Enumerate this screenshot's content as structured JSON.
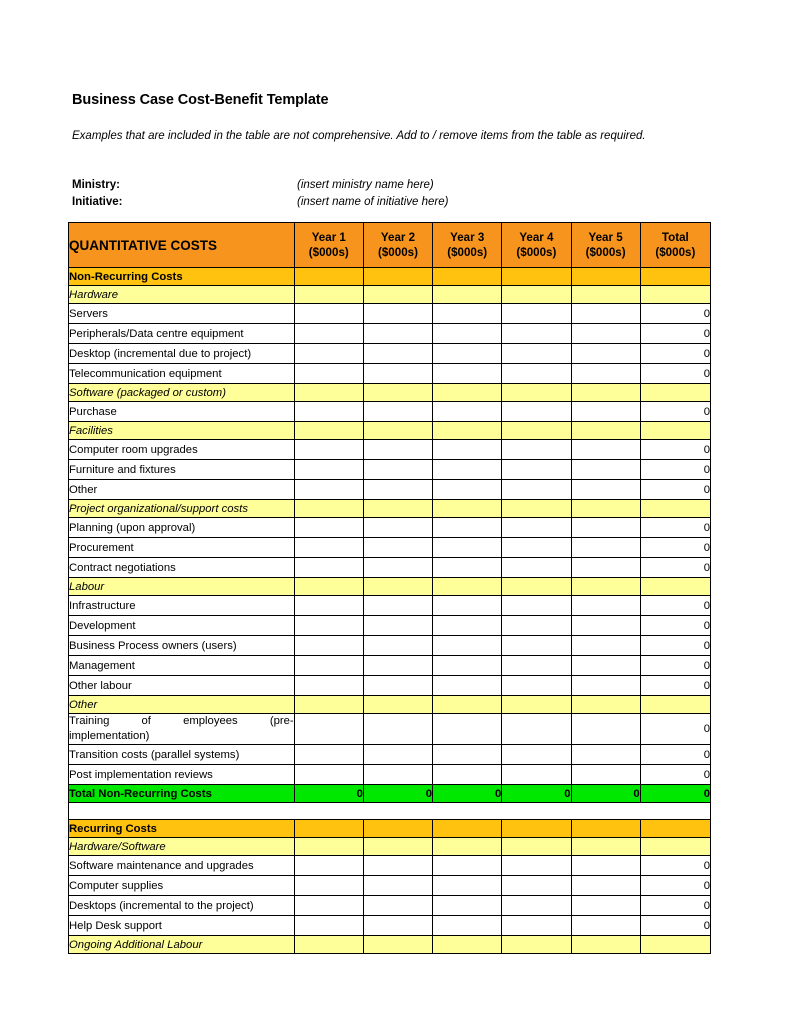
{
  "document": {
    "title": "Business Case Cost-Benefit Template",
    "intro": "Examples that are included in the table are not comprehensive.  Add to / remove items from the table as required.",
    "meta": [
      {
        "label": "Ministry:",
        "value": "(insert ministry name here)"
      },
      {
        "label": "Initiative:",
        "value": "(insert name of initiative here)"
      }
    ]
  },
  "colors": {
    "header_orange": "#F7941E",
    "group_gold": "#FFC20E",
    "subgroup_yellow": "#FFFF99",
    "total_green": "#00E800",
    "border": "#000000",
    "page_background": "#FFFFFF"
  },
  "table": {
    "header": {
      "title": "QUANTITATIVE COSTS",
      "columns": [
        {
          "line1": "Year 1",
          "line2": "($000s)"
        },
        {
          "line1": "Year 2",
          "line2": "($000s)"
        },
        {
          "line1": "Year 3",
          "line2": "($000s)"
        },
        {
          "line1": "Year 4",
          "line2": "($000s)"
        },
        {
          "line1": "Year 5",
          "line2": "($000s)"
        },
        {
          "line1": "Total",
          "line2": "($000s)"
        }
      ]
    },
    "rows": [
      {
        "type": "group",
        "label": "Non-Recurring Costs",
        "values": [
          "",
          "",
          "",
          "",
          "",
          ""
        ]
      },
      {
        "type": "sub",
        "label": "Hardware",
        "values": [
          "",
          "",
          "",
          "",
          "",
          ""
        ]
      },
      {
        "type": "item",
        "label": "Servers",
        "values": [
          "",
          "",
          "",
          "",
          "",
          "0"
        ]
      },
      {
        "type": "item",
        "label": "Peripherals/Data centre equipment",
        "values": [
          "",
          "",
          "",
          "",
          "",
          "0"
        ]
      },
      {
        "type": "item",
        "label": "Desktop (incremental due to project)",
        "values": [
          "",
          "",
          "",
          "",
          "",
          "0"
        ]
      },
      {
        "type": "item",
        "label": "Telecommunication equipment",
        "values": [
          "",
          "",
          "",
          "",
          "",
          "0"
        ]
      },
      {
        "type": "sub",
        "label": "Software (packaged or custom)",
        "values": [
          "",
          "",
          "",
          "",
          "",
          ""
        ]
      },
      {
        "type": "item",
        "label": "Purchase",
        "values": [
          "",
          "",
          "",
          "",
          "",
          "0"
        ]
      },
      {
        "type": "sub",
        "label": "Facilities",
        "values": [
          "",
          "",
          "",
          "",
          "",
          ""
        ]
      },
      {
        "type": "item",
        "label": "Computer room upgrades",
        "values": [
          "",
          "",
          "",
          "",
          "",
          "0"
        ]
      },
      {
        "type": "item",
        "label": "Furniture and fixtures",
        "values": [
          "",
          "",
          "",
          "",
          "",
          "0"
        ]
      },
      {
        "type": "item",
        "label": "Other",
        "values": [
          "",
          "",
          "",
          "",
          "",
          "0"
        ]
      },
      {
        "type": "sub",
        "label": "Project organizational/support costs",
        "values": [
          "",
          "",
          "",
          "",
          "",
          ""
        ]
      },
      {
        "type": "item",
        "label": "Planning (upon approval)",
        "values": [
          "",
          "",
          "",
          "",
          "",
          "0"
        ]
      },
      {
        "type": "item",
        "label": "Procurement",
        "values": [
          "",
          "",
          "",
          "",
          "",
          "0"
        ]
      },
      {
        "type": "item",
        "label": "Contract negotiations",
        "values": [
          "",
          "",
          "",
          "",
          "",
          "0"
        ]
      },
      {
        "type": "sub",
        "label": "Labour",
        "values": [
          "",
          "",
          "",
          "",
          "",
          ""
        ]
      },
      {
        "type": "item",
        "label": "Infrastructure",
        "values": [
          "",
          "",
          "",
          "",
          "",
          "0"
        ]
      },
      {
        "type": "item",
        "label": "Development",
        "values": [
          "",
          "",
          "",
          "",
          "",
          "0"
        ]
      },
      {
        "type": "item",
        "label": "Business Process owners (users)",
        "values": [
          "",
          "",
          "",
          "",
          "",
          "0"
        ]
      },
      {
        "type": "item",
        "label": "Management",
        "values": [
          "",
          "",
          "",
          "",
          "",
          "0"
        ]
      },
      {
        "type": "item",
        "label": "Other labour",
        "values": [
          "",
          "",
          "",
          "",
          "",
          "0"
        ]
      },
      {
        "type": "sub",
        "label": "Other",
        "values": [
          "",
          "",
          "",
          "",
          "",
          ""
        ]
      },
      {
        "type": "item-justified",
        "label": "Training of employees (pre-implementation)",
        "label_line1": "Training of employees (pre-",
        "label_line2": "implementation)",
        "values": [
          "",
          "",
          "",
          "",
          "",
          "0"
        ]
      },
      {
        "type": "item",
        "label": "Transition costs (parallel systems)",
        "values": [
          "",
          "",
          "",
          "",
          "",
          "0"
        ]
      },
      {
        "type": "item",
        "label": "Post implementation reviews",
        "values": [
          "",
          "",
          "",
          "",
          "",
          "0"
        ]
      },
      {
        "type": "total",
        "label": "Total Non-Recurring Costs",
        "values": [
          "0",
          "0",
          "0",
          "0",
          "0",
          "0"
        ]
      },
      {
        "type": "spacer",
        "label": "",
        "values": []
      },
      {
        "type": "group",
        "label": "Recurring Costs",
        "values": [
          "",
          "",
          "",
          "",
          "",
          ""
        ]
      },
      {
        "type": "sub",
        "label": "Hardware/Software",
        "values": [
          "",
          "",
          "",
          "",
          "",
          ""
        ]
      },
      {
        "type": "item",
        "label": "Software maintenance and upgrades",
        "values": [
          "",
          "",
          "",
          "",
          "",
          "0"
        ]
      },
      {
        "type": "item",
        "label": "Computer supplies",
        "values": [
          "",
          "",
          "",
          "",
          "",
          "0"
        ]
      },
      {
        "type": "item",
        "label": "Desktops (incremental to the project)",
        "values": [
          "",
          "",
          "",
          "",
          "",
          "0"
        ]
      },
      {
        "type": "item",
        "label": "Help Desk support",
        "values": [
          "",
          "",
          "",
          "",
          "",
          "0"
        ]
      },
      {
        "type": "sub",
        "label": "Ongoing Additional Labour",
        "values": [
          "",
          "",
          "",
          "",
          "",
          ""
        ]
      }
    ]
  }
}
